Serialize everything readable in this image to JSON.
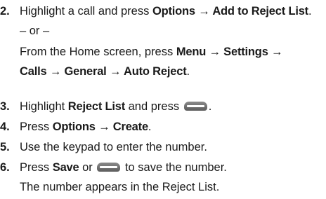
{
  "steps": [
    {
      "num": "2.",
      "lines": [
        {
          "parts": [
            {
              "t": "Highlight a call and press "
            },
            {
              "b": "Options → Add to Reject List"
            },
            {
              "t": "."
            }
          ]
        },
        {
          "parts": [
            {
              "t": "– or –"
            }
          ]
        },
        {
          "parts": [
            {
              "t": "From the Home screen, press "
            },
            {
              "b": "Menu → Settings →"
            }
          ]
        },
        {
          "parts": [
            {
              "b": "Calls → General → Auto Reject"
            },
            {
              "t": "."
            }
          ]
        }
      ]
    },
    {
      "num": "3.",
      "lines": [
        {
          "parts": [
            {
              "t": "Highlight "
            },
            {
              "b": "Reject List"
            },
            {
              "t": " and press "
            },
            {
              "key": "soft-key-icon"
            },
            {
              "t": "."
            }
          ]
        }
      ]
    },
    {
      "num": "4.",
      "lines": [
        {
          "parts": [
            {
              "t": "Press "
            },
            {
              "b": "Options → Create"
            },
            {
              "t": "."
            }
          ]
        }
      ]
    },
    {
      "num": "5.",
      "lines": [
        {
          "parts": [
            {
              "t": "Use the keypad to enter the number."
            }
          ]
        }
      ]
    },
    {
      "num": "6.",
      "lines": [
        {
          "parts": [
            {
              "t": "Press "
            },
            {
              "b": "Save"
            },
            {
              "t": " or "
            },
            {
              "key": "soft-key-icon"
            },
            {
              "t": " to save the number."
            }
          ]
        },
        {
          "parts": [
            {
              "t": "The number appears in the Reject List."
            }
          ]
        }
      ]
    }
  ]
}
